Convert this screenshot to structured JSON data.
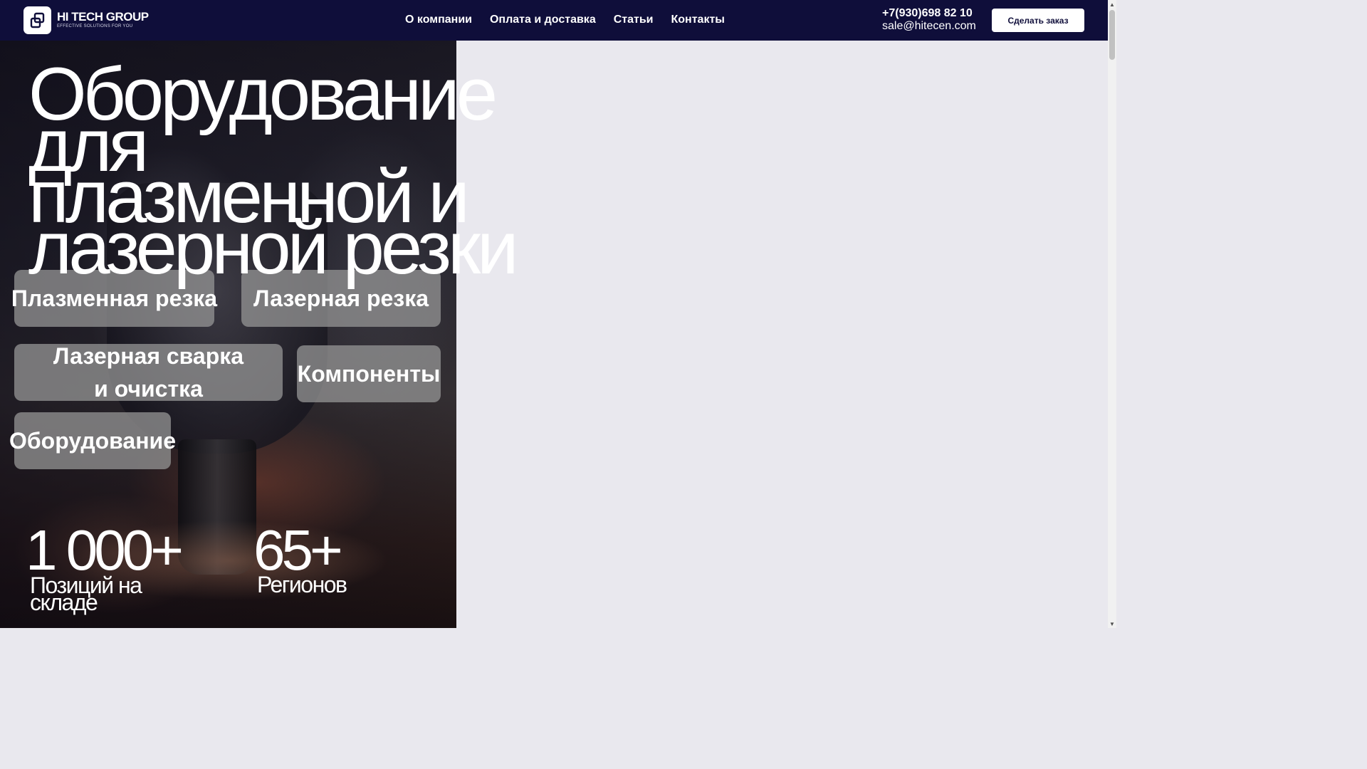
{
  "header": {
    "logo_name": "HI TECH GROUP",
    "logo_tagline": "EFFECTIVE SOLUTIONS FOR YOU",
    "nav": [
      {
        "label": "О компании"
      },
      {
        "label": "Оплата и доставка"
      },
      {
        "label": "Статьи"
      },
      {
        "label": "Контакты"
      }
    ],
    "phone": "+7(930)698 82 10",
    "email": "sale@hitecen.com",
    "order_button": "Сделать заказ"
  },
  "hero": {
    "title": "Оборудование для плазменной и лазерной резки",
    "categories": [
      {
        "label": "Плазменная резка"
      },
      {
        "label": "Лазерная резка"
      },
      {
        "label": "Лазерная сварка и очистка"
      },
      {
        "label": "Компоненты"
      },
      {
        "label": "Оборудование"
      }
    ],
    "stats": [
      {
        "value": "1 000+",
        "label": "Позиций на складе"
      },
      {
        "value": "65+",
        "label": "Регионов"
      }
    ]
  },
  "colors": {
    "header_bg": "#0f0e3a",
    "page_bg": "#e9e8ee",
    "button_bg": "#ffffff",
    "category_bg": "#969696"
  }
}
